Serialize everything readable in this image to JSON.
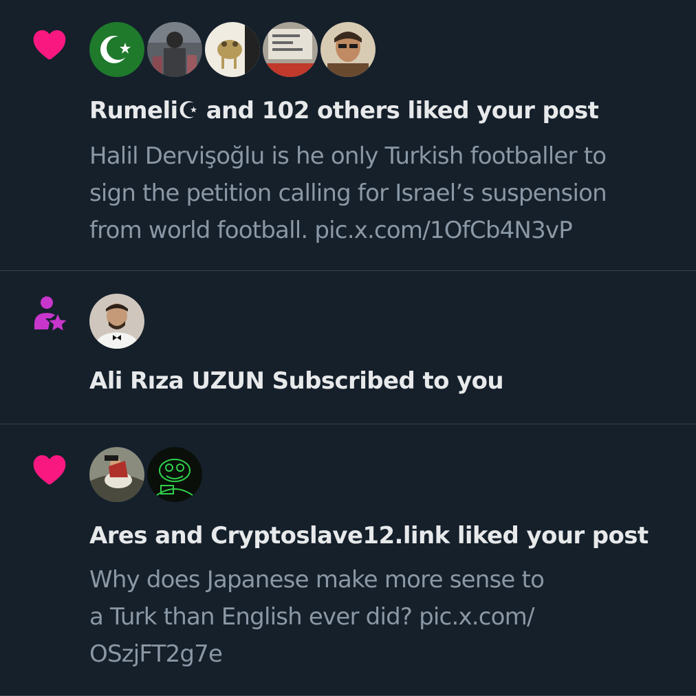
{
  "notifications": [
    {
      "type_icon": "heart-icon",
      "headline": "Rumeli☪ and 102 others liked your post",
      "post_text": "Halil Dervişoğlu is he only Turkish footballer to\nsign the petition calling for Israel’s suspension\nfrom world football. pic.x.com/1OfCb4N3vP"
    },
    {
      "type_icon": "subscriber-star-icon",
      "headline": "Ali Rıza UZUN Subscribed to you"
    },
    {
      "type_icon": "heart-icon",
      "headline": "Ares and Cryptoslave12.link liked your post",
      "post_text": "Why does Japanese make more sense to\na Turk than English ever did? pic.x.com/\nOSzjFT2g7e"
    }
  ],
  "colors": {
    "background": "#15202b",
    "divider": "#38444d",
    "like_pink": "#f91880",
    "subscribe_purple": "#c936cc",
    "primary_text": "#e7e9ea",
    "secondary_text": "#8b98a5"
  }
}
